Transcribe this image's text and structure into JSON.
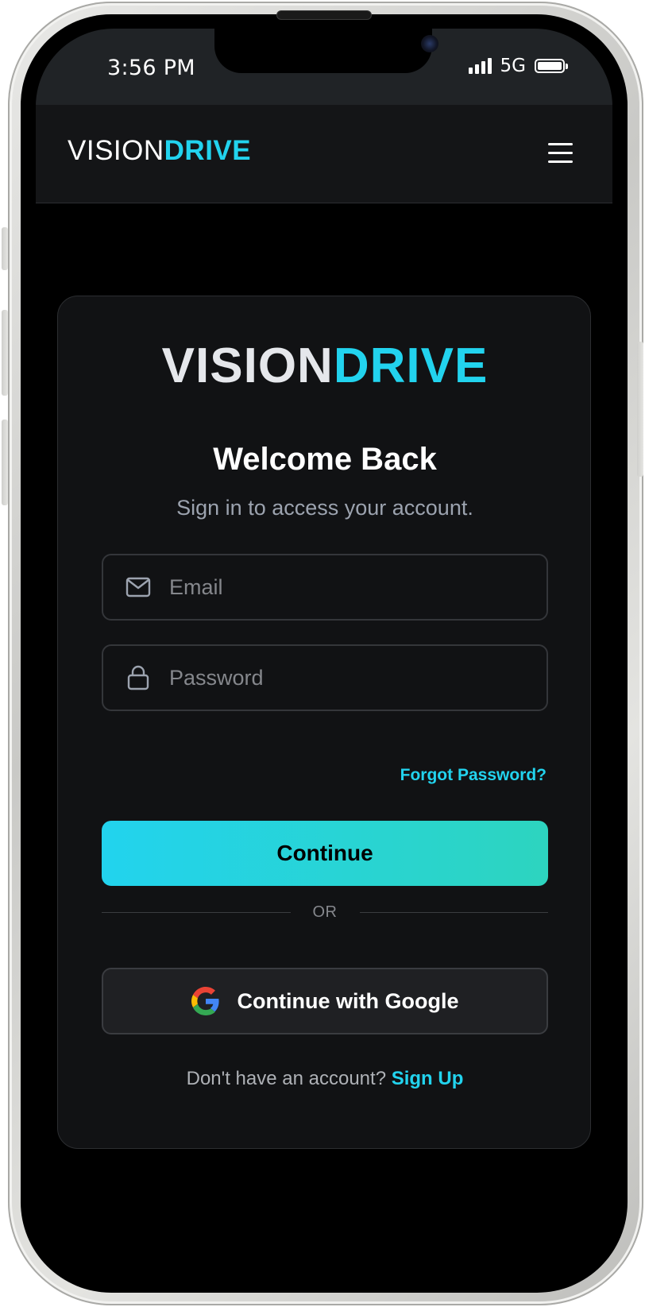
{
  "status_bar": {
    "time": "3:56 PM",
    "network": "5G",
    "icons": [
      "signal-bars-icon",
      "battery-icon"
    ]
  },
  "header": {
    "logo_part1": "VISION",
    "logo_part2": "DRIVE",
    "menu_icon": "hamburger-menu-icon"
  },
  "card": {
    "logo_part1": "VISION",
    "logo_part2": "DRIVE",
    "title": "Welcome Back",
    "subtitle": "Sign in to access your account.",
    "email": {
      "placeholder": "Email",
      "value": "",
      "icon": "mail-icon"
    },
    "password": {
      "placeholder": "Password",
      "value": "",
      "icon": "lock-icon"
    },
    "forgot_password": "Forgot Password?",
    "continue_label": "Continue",
    "divider_text": "OR",
    "google_label": "Continue with Google",
    "google_icon": "google-logo-icon",
    "signup_prompt": "Don't have an account?",
    "signup_link": "Sign Up"
  },
  "colors": {
    "accent": "#22d3ee",
    "accent_gradient_end": "#2dd4bf",
    "background": "#000000",
    "card": "#111214",
    "header": "#141517"
  }
}
